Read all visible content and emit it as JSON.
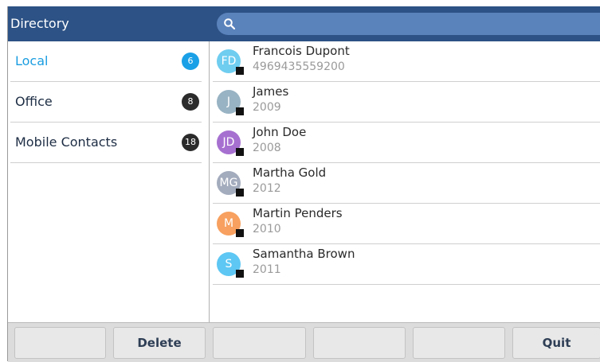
{
  "header": {
    "title": "Directory"
  },
  "search": {
    "icon": "search-icon"
  },
  "sidebar": {
    "items": [
      {
        "label": "Local",
        "count": "6",
        "active": true
      },
      {
        "label": "Office",
        "count": "8",
        "active": false
      },
      {
        "label": "Mobile Contacts",
        "count": "18",
        "active": false
      }
    ]
  },
  "contacts": [
    {
      "initials": "FD",
      "name": "Francois Dupont",
      "number": "4969435559200",
      "color": "#6fcdf0"
    },
    {
      "initials": "J",
      "name": "James",
      "number": "2009",
      "color": "#98b3c3"
    },
    {
      "initials": "JD",
      "name": "John Doe",
      "number": "2008",
      "color": "#a670d0"
    },
    {
      "initials": "MG",
      "name": "Martha Gold",
      "number": "2012",
      "color": "#a3acbd"
    },
    {
      "initials": "M",
      "name": "Martin Penders",
      "number": "2010",
      "color": "#f7a05f"
    },
    {
      "initials": "S",
      "name": "Samantha Brown",
      "number": "2011",
      "color": "#5ec7f3"
    }
  ],
  "softkeys": [
    "",
    "Delete",
    "",
    "",
    "",
    "Quit"
  ],
  "colors": {
    "header": "#2d5285",
    "search": "#5a82bb",
    "accent": "#1a9de0"
  }
}
